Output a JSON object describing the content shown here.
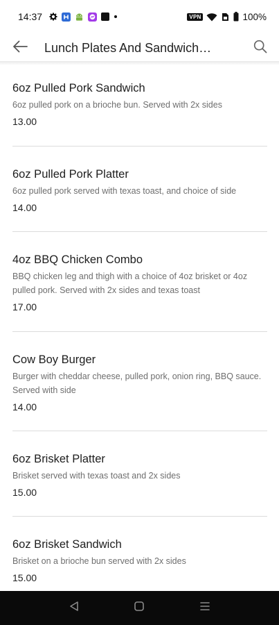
{
  "status_bar": {
    "time": "14:37",
    "vpn": "VPN",
    "battery": "100%",
    "icons": [
      "gear-icon",
      "app-h-icon",
      "android-icon",
      "messenger-icon",
      "square-app-icon",
      "dot-icon",
      "vpn-icon",
      "wifi-icon",
      "sim-icon",
      "battery-icon"
    ]
  },
  "app_bar": {
    "title": "Lunch Plates And Sandwich…",
    "back_icon": "arrow-left-icon",
    "search_icon": "search-icon"
  },
  "items": [
    {
      "name": "6oz Pulled Pork Sandwich",
      "description": "6oz pulled pork on a brioche bun. Served with 2x sides",
      "price": "13.00"
    },
    {
      "name": "6oz Pulled Pork Platter",
      "description": "6oz pulled pork served with texas toast, and choice of side",
      "price": "14.00"
    },
    {
      "name": "4oz BBQ Chicken Combo",
      "description": "BBQ chicken leg and thigh with a choice of 4oz brisket or 4oz pulled pork. Served with 2x sides and texas toast",
      "price": "17.00"
    },
    {
      "name": "Cow Boy Burger",
      "description": "Burger with cheddar cheese, pulled pork, onion ring, BBQ sauce. Served with side",
      "price": "14.00"
    },
    {
      "name": "6oz Brisket Platter",
      "description": "Brisket served with texas toast and 2x sides",
      "price": "15.00"
    },
    {
      "name": "6oz Brisket Sandwich",
      "description": "Brisket on a brioche bun served with 2x sides",
      "price": "15.00"
    }
  ],
  "nav_bar": {
    "icons": [
      "nav-back-icon",
      "nav-home-icon",
      "nav-recents-icon"
    ]
  },
  "colors": {
    "text_primary": "#1e1e1e",
    "text_secondary": "#6e6e6e",
    "divider": "#dcdcdc",
    "nav_bar": "#0a0a0a"
  }
}
